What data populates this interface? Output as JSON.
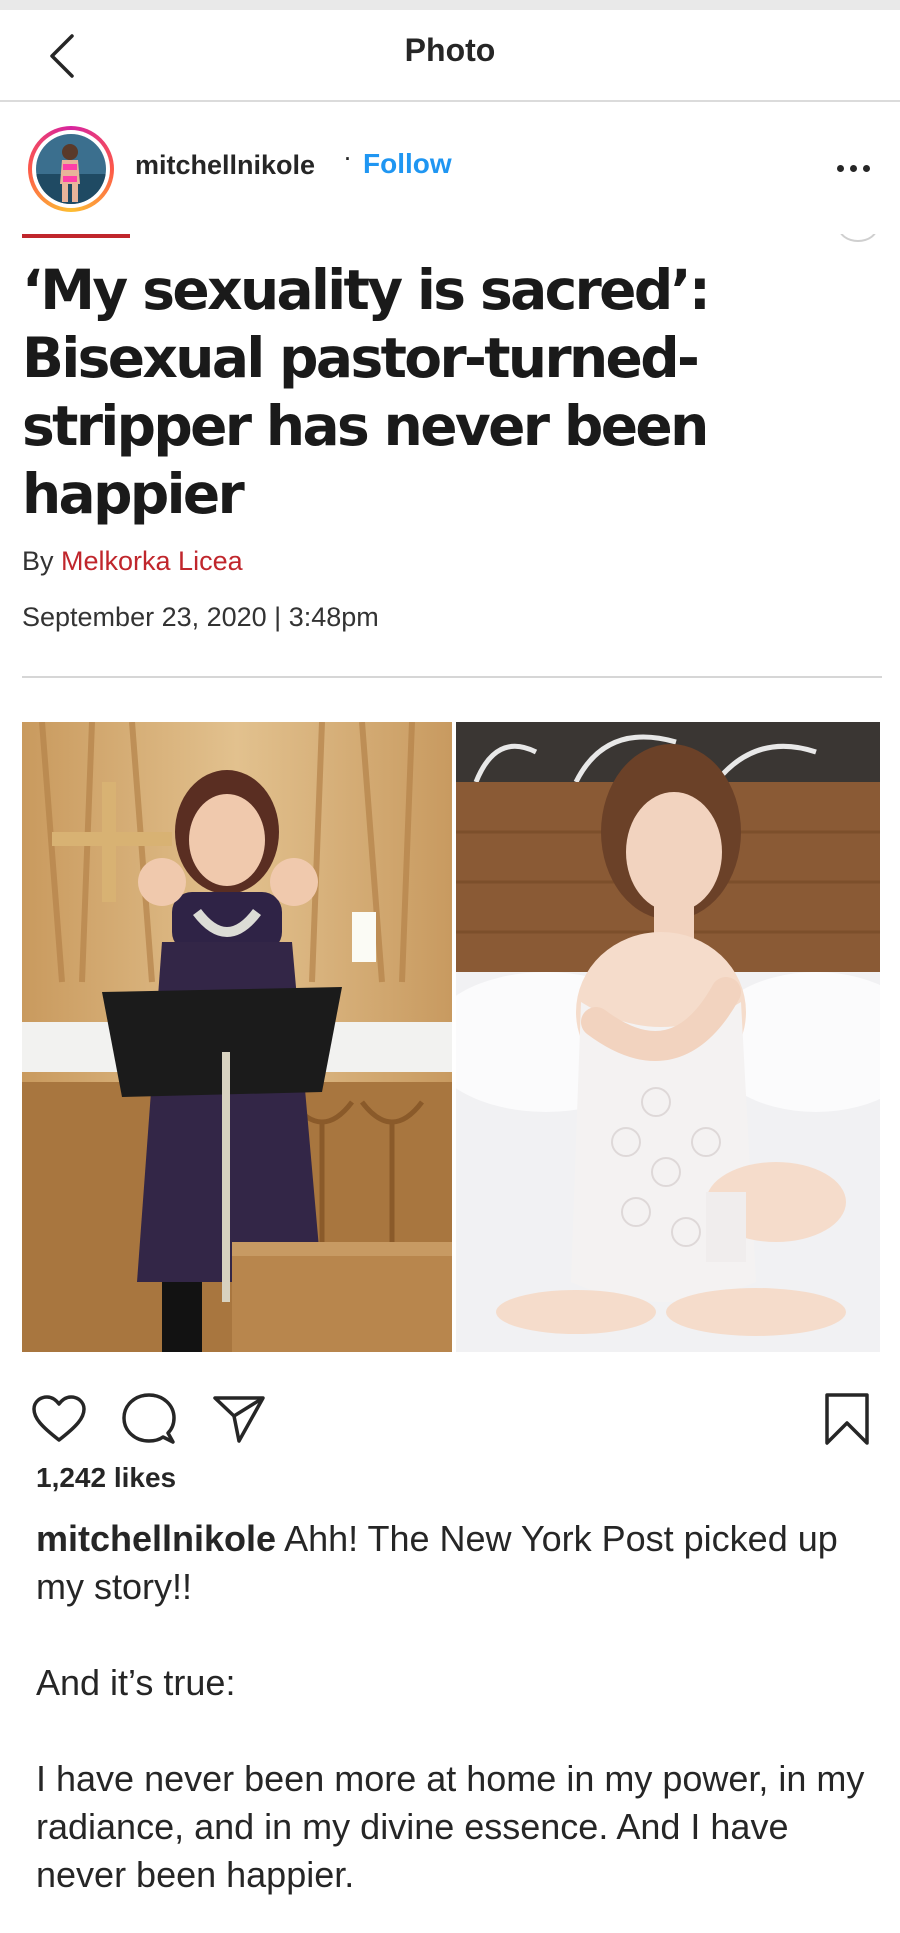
{
  "top_bar": {
    "title": "Photo"
  },
  "post": {
    "username": "mitchellnikole",
    "follow_separator": "·",
    "follow_label": "Follow",
    "likes": "1,242 likes"
  },
  "article": {
    "headline": "‘My sexuality is sacred’: Bisexual pastor-turned-stripper has never been happier",
    "byline_prefix": "By",
    "author": "Melkorka Licea",
    "date": "September 23, 2020 | 3:48pm"
  },
  "caption": {
    "username": "mitchellnikole",
    "line1": "Ahh! The New York Post picked up my story!!",
    "line2": "And it’s true:",
    "line3": "I have never been more at home in my power, in my radiance, and in my divine essence. And I have never been happier."
  },
  "icons": {
    "back": "chevron-left-icon",
    "more": "more-horizontal-icon",
    "like": "heart-icon",
    "comment": "comment-icon",
    "share": "paper-plane-icon",
    "save": "bookmark-icon"
  },
  "colors": {
    "follow": "#1f96f2",
    "article_accent": "#c0262c",
    "text": "#262626"
  }
}
